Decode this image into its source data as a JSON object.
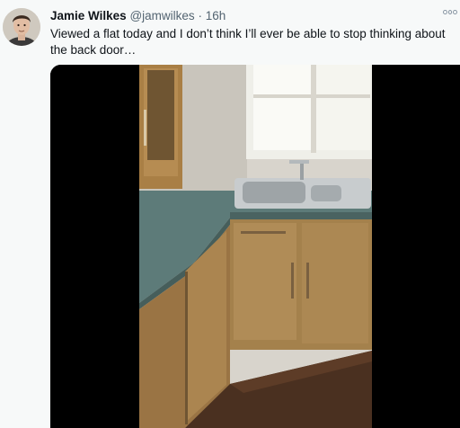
{
  "tweet": {
    "author_name": "Jamie Wilkes",
    "author_handle": "@jamwilkes",
    "separator": "·",
    "timestamp": "16h",
    "text": "Viewed a flat today and I don’t think I’ll ever be able to stop thinking about the back door…"
  },
  "icons": {
    "more": "more-options-icon"
  }
}
